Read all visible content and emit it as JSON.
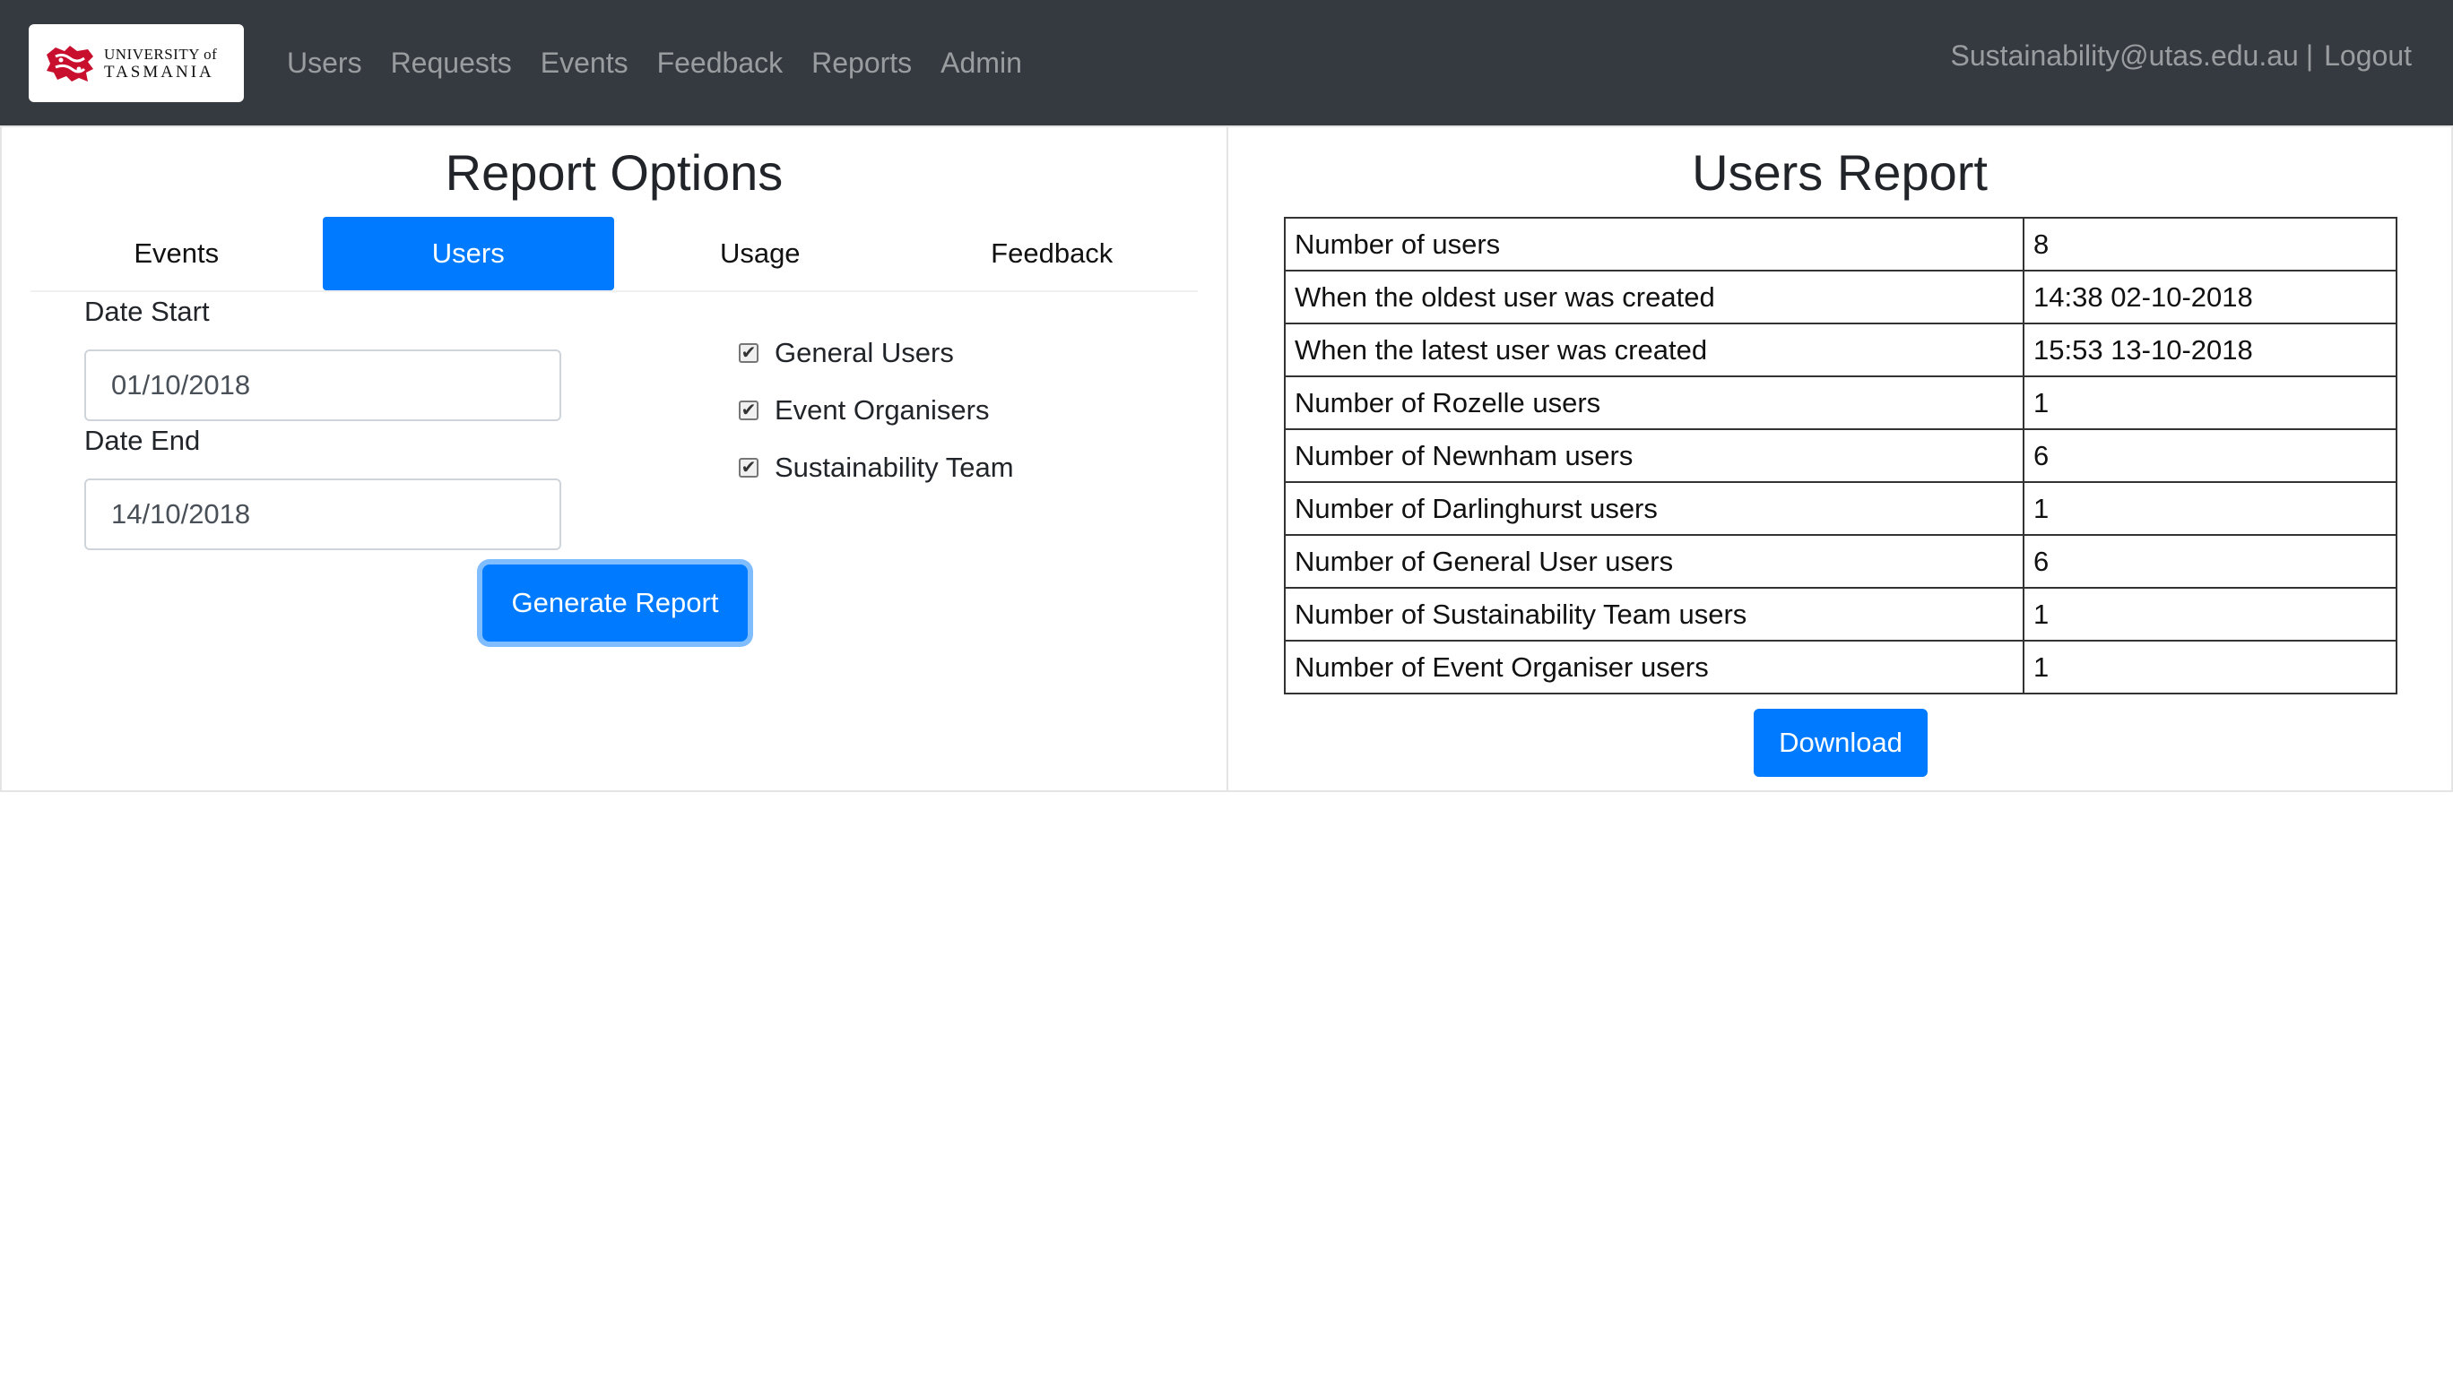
{
  "brand": {
    "line1": "UNIVERSITY of",
    "line2": "TASMANIA",
    "logo_icon": "tasmanian-lion-crest-icon"
  },
  "nav": {
    "links": [
      "Users",
      "Requests",
      "Events",
      "Feedback",
      "Reports",
      "Admin"
    ],
    "user_email": "Sustainability@utas.edu.au",
    "separator": "|",
    "logout": "Logout"
  },
  "options": {
    "title": "Report Options",
    "tabs": [
      "Events",
      "Users",
      "Usage",
      "Feedback"
    ],
    "active_tab": "Users",
    "date_start_label": "Date Start",
    "date_start_value": "01/10/2018",
    "date_end_label": "Date End",
    "date_end_value": "14/10/2018",
    "checkboxes": [
      {
        "label": "General Users",
        "checked": true
      },
      {
        "label": "Event Organisers",
        "checked": true
      },
      {
        "label": "Sustainability Team",
        "checked": true
      }
    ],
    "generate_label": "Generate Report"
  },
  "report": {
    "title": "Users Report",
    "rows": [
      {
        "key": "Number of users",
        "value": "8"
      },
      {
        "key": "When the oldest user was created",
        "value": "14:38 02-10-2018"
      },
      {
        "key": "When the latest user was created",
        "value": "15:53 13-10-2018"
      },
      {
        "key": "Number of Rozelle users",
        "value": "1"
      },
      {
        "key": "Number of Newnham users",
        "value": "6"
      },
      {
        "key": "Number of Darlinghurst users",
        "value": "1"
      },
      {
        "key": "Number of General User users",
        "value": "6"
      },
      {
        "key": "Number of Sustainability Team users",
        "value": "1"
      },
      {
        "key": "Number of Event Organiser users",
        "value": "1"
      }
    ],
    "download_label": "Download"
  },
  "colors": {
    "navbar": "#343a40",
    "primary": "#007bff"
  }
}
